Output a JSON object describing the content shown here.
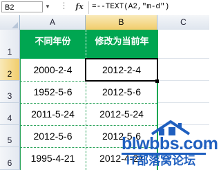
{
  "formula_bar": {
    "name_box": "B2",
    "fx_label": "fx",
    "formula": "=--TEXT(A2,\"m-d\")"
  },
  "columns": [
    "A",
    "B",
    "C"
  ],
  "rows": [
    "1",
    "2",
    "3",
    "4",
    "5",
    "6"
  ],
  "table": {
    "headers": [
      "不同年份",
      "修改为当前年"
    ],
    "data": [
      [
        "2000-2-4",
        "2012-2-4"
      ],
      [
        "1952-5-6",
        "2012-5-6"
      ],
      [
        "2011-5-24",
        "2012-5-24"
      ],
      [
        "2012-5-6",
        "2012-5-6"
      ],
      [
        "1995-4-21",
        "2012-4-21"
      ]
    ]
  },
  "selected_cell": "B2",
  "watermark": {
    "domain": "blwbbs.com",
    "subtitle": "IT部落窝论坛"
  },
  "colors": {
    "header_fill": "#00a651",
    "header_text": "#ffffff",
    "border": "#2aa35a",
    "watermark": "#1f5fbf"
  }
}
